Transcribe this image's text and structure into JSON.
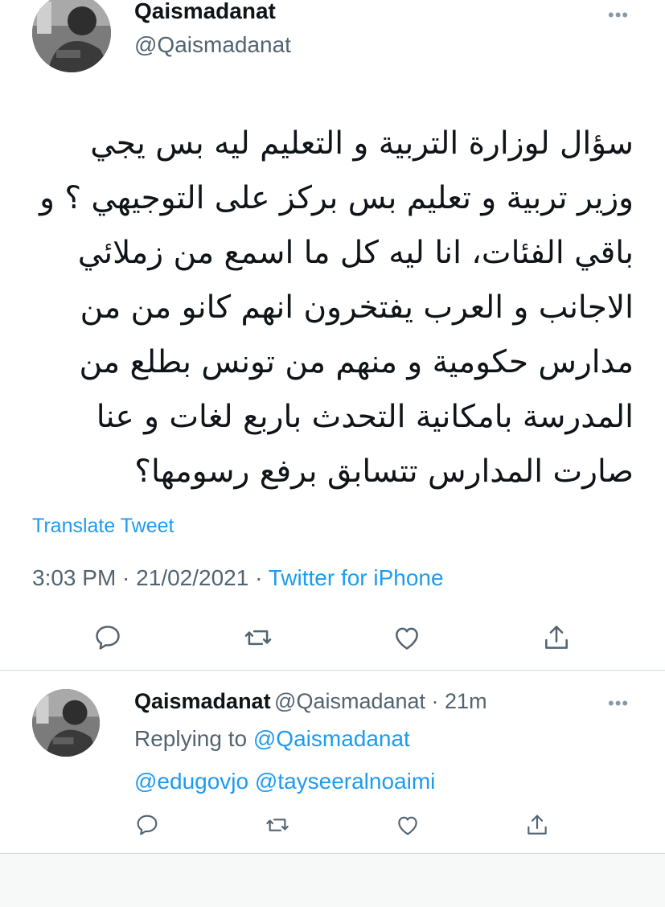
{
  "main_tweet": {
    "display_name": "Qaismadanat",
    "handle": "@Qaismadanat",
    "text_lines": [
      "سؤال لوزارة التربية و التعليم ليه بس يجي",
      "وزير تربية و تعليم بس بركز على التوجيهي ؟ و",
      "باقي الفئات، انا ليه كل ما اسمع من زملائي",
      "الاجانب و العرب يفتخرون انهم كانو من من",
      "مدارس حكومية و منهم من تونس بطلع من",
      "المدرسة بامكانية التحدث باربع لغات و عنا",
      "صارت المدارس تتسابق برفع رسومها؟"
    ],
    "translate_label": "Translate Tweet",
    "time": "3:03 PM",
    "separator": " · ",
    "date": "21/02/2021",
    "source": "Twitter for iPhone",
    "actions": [
      "reply-icon",
      "retweet-icon",
      "like-icon",
      "share-icon"
    ]
  },
  "reply_tweet": {
    "display_name": "Qaismadanat",
    "handle": "@Qaismadanat",
    "dot": " · ",
    "age": "21m",
    "replying_prefix": "Replying to ",
    "replying_to": "@Qaismadanat",
    "mention_1": "@edugovjo",
    "mention_2": "@tayseeralnoaimi",
    "actions": [
      "reply-icon",
      "retweet-icon",
      "like-icon",
      "share-icon"
    ]
  },
  "icons": {
    "more": "•••"
  },
  "colors": {
    "link": "#1d9bf0",
    "secondary": "#536471",
    "icon": "#536471",
    "divider": "#cfd9de"
  }
}
